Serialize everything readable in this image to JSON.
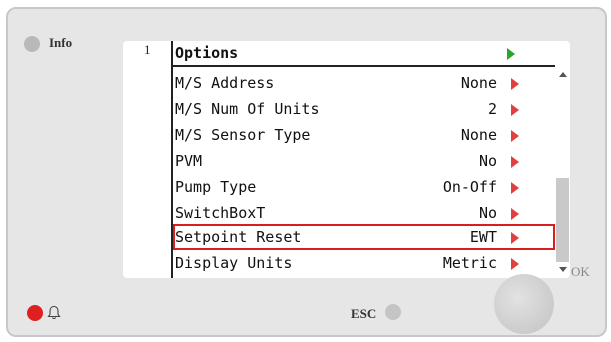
{
  "info": {
    "label": "Info"
  },
  "header": {
    "line_number": "1",
    "title": "Options"
  },
  "options": [
    {
      "label": "M/S Address",
      "value": "None"
    },
    {
      "label": "M/S Num Of Units",
      "value": "2"
    },
    {
      "label": "M/S Sensor Type",
      "value": "None"
    },
    {
      "label": "PVM",
      "value": "No"
    },
    {
      "label": "Pump Type",
      "value": "On-Off"
    },
    {
      "label": "SwitchBoxT",
      "value": "No"
    },
    {
      "label": "Setpoint Reset",
      "value": "EWT",
      "selected": true
    },
    {
      "label": "Display Units",
      "value": "Metric"
    }
  ],
  "buttons": {
    "esc_label": "ESC",
    "ok_label": "OK"
  },
  "colors": {
    "alarm_led": "#e02020",
    "info_led": "#b9b9b9",
    "nav_arrow_green": "#2aa52a",
    "nav_arrow_red": "#e04040",
    "selection_border": "#d81f1f"
  },
  "icons": {
    "alarm": "bell-icon"
  }
}
